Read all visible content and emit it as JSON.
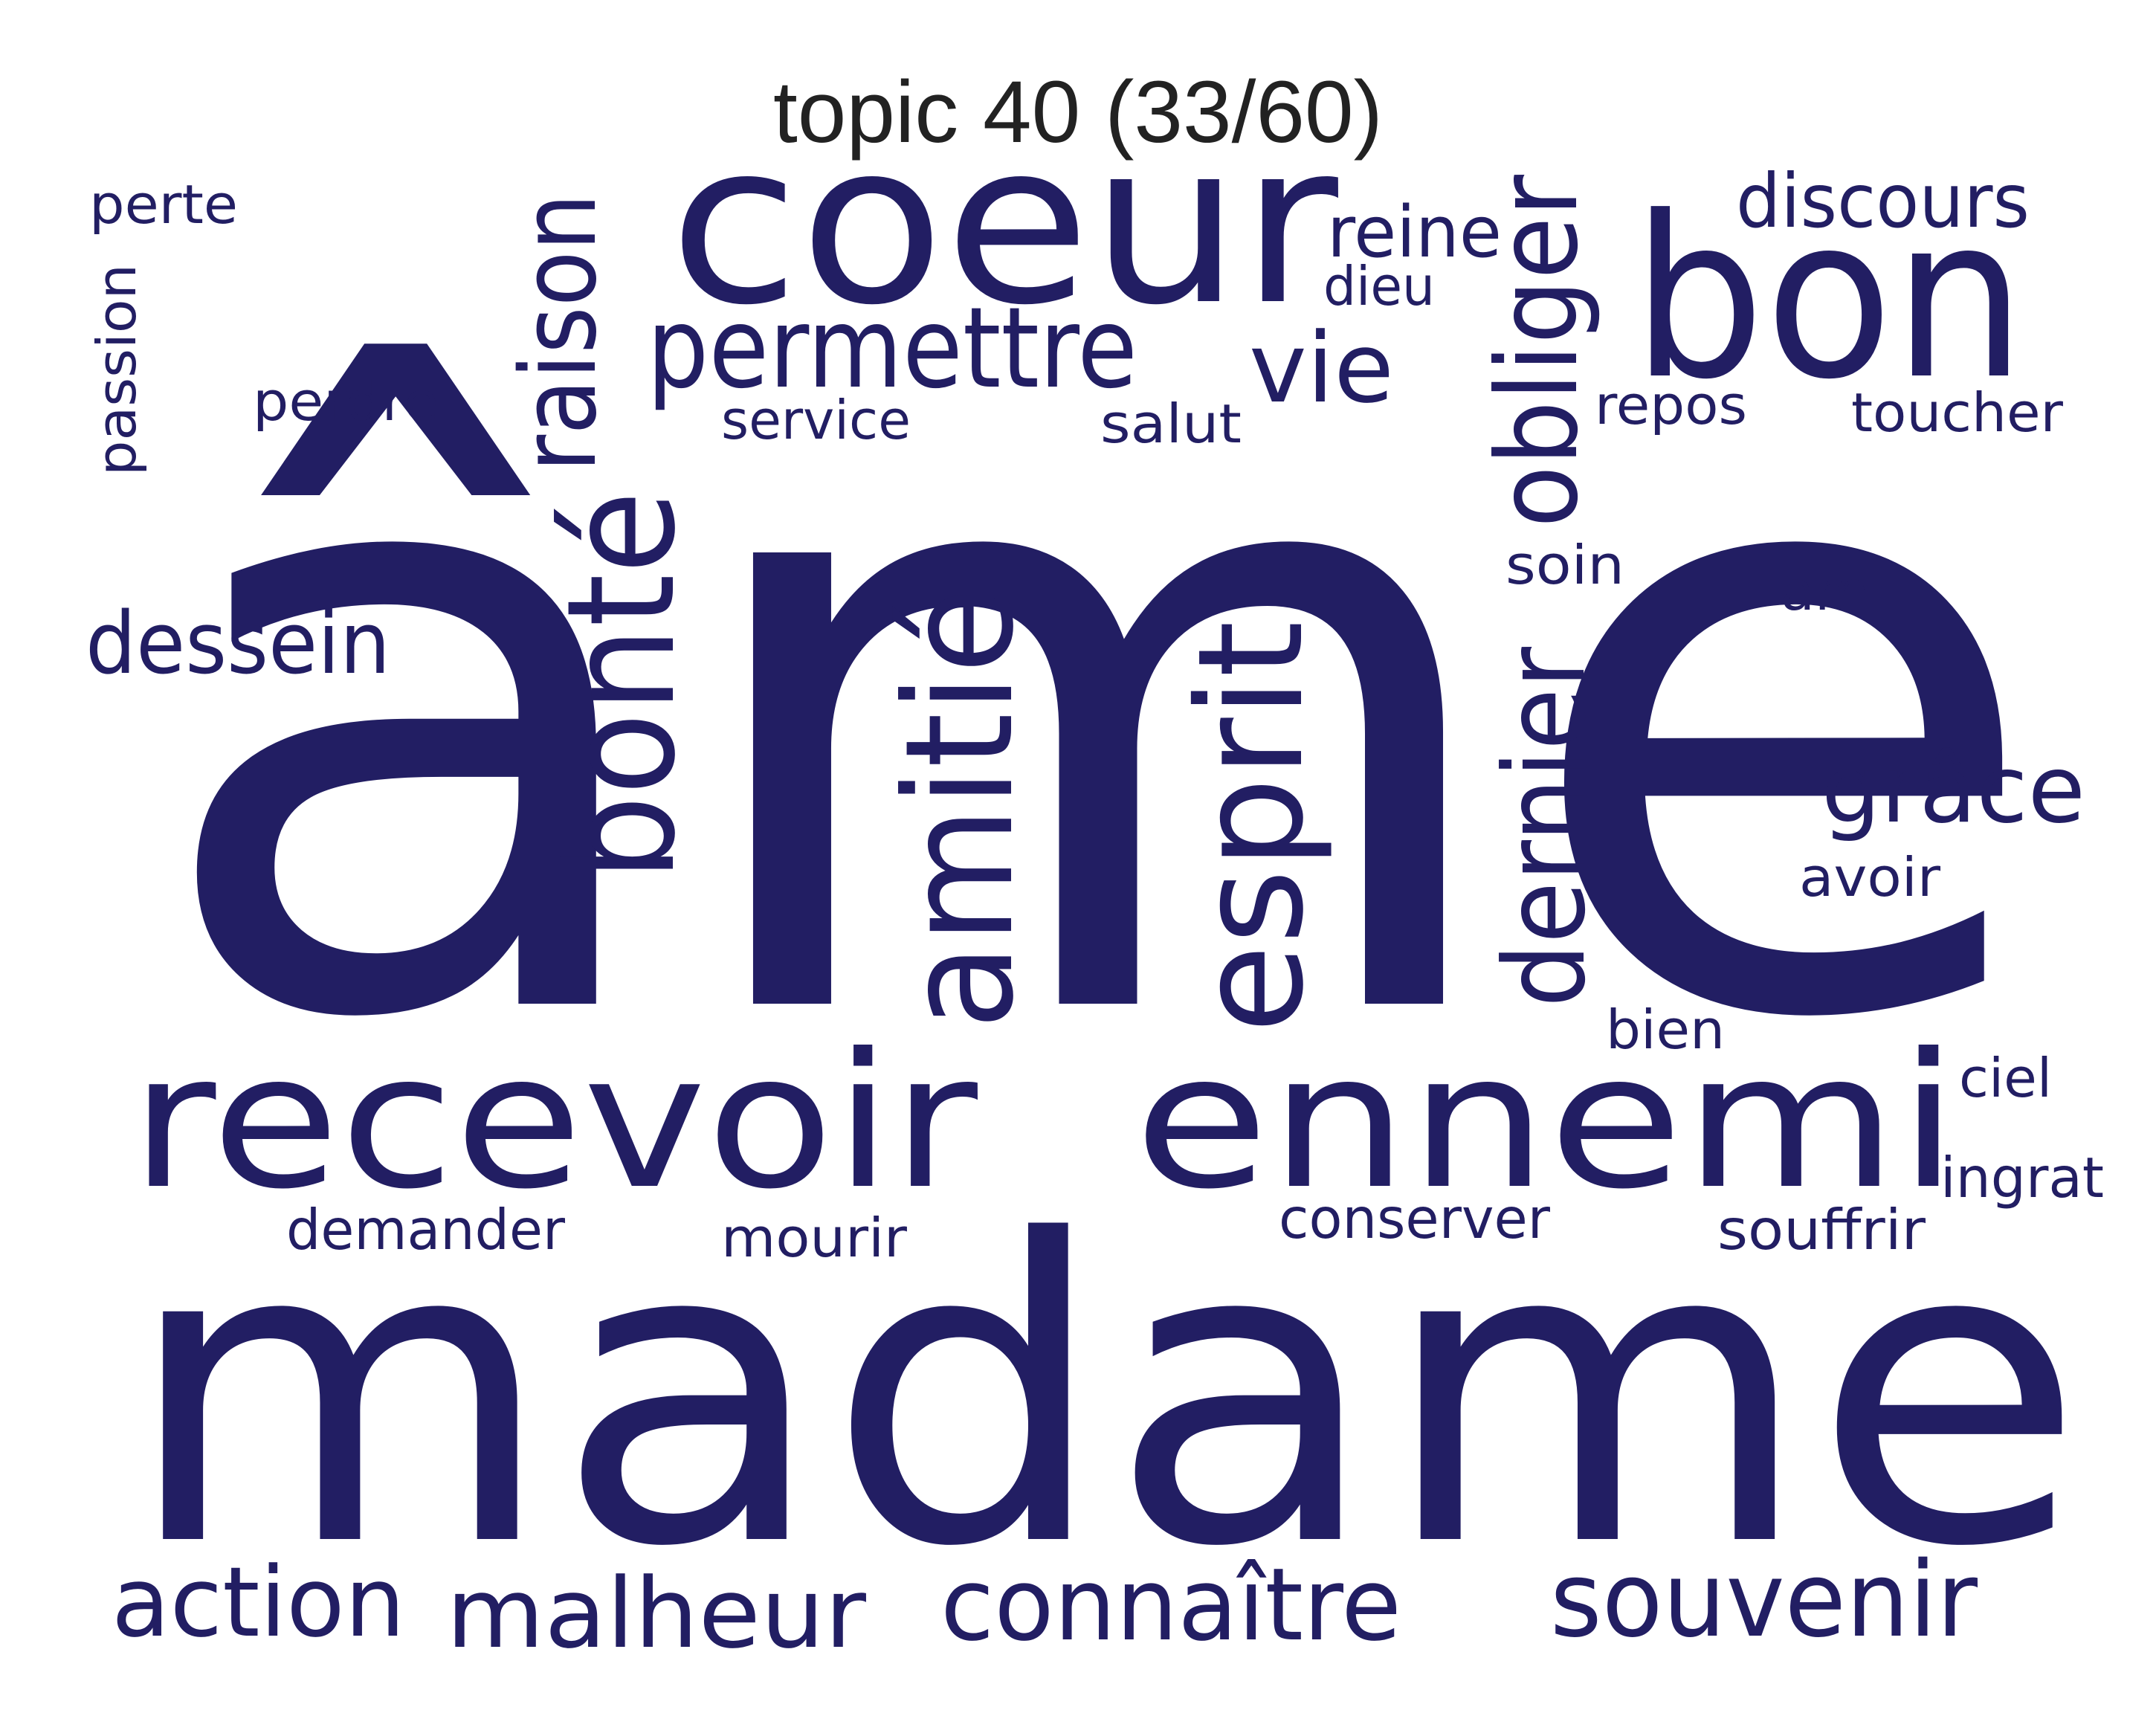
{
  "title": "topic 40 (33/60)",
  "color": "#221e63",
  "words": [
    {
      "id": "ame",
      "text": "âme",
      "weight": 1.0,
      "vertical": false
    },
    {
      "id": "madame",
      "text": "madame",
      "weight": 0.78,
      "vertical": false
    },
    {
      "id": "coeur",
      "text": "coeur",
      "weight": 0.42,
      "vertical": false
    },
    {
      "id": "bon",
      "text": "bon",
      "weight": 0.42,
      "vertical": false
    },
    {
      "id": "recevoir",
      "text": "recevoir",
      "weight": 0.36,
      "vertical": false
    },
    {
      "id": "ennemi",
      "text": "ennemi",
      "weight": 0.34,
      "vertical": false
    },
    {
      "id": "amitie",
      "text": "amitié",
      "weight": 0.3,
      "vertical": true
    },
    {
      "id": "bonte",
      "text": "bonté",
      "weight": 0.28,
      "vertical": true
    },
    {
      "id": "esprit",
      "text": "esprit",
      "weight": 0.28,
      "vertical": true
    },
    {
      "id": "dernier",
      "text": "dernier",
      "weight": 0.22,
      "vertical": true
    },
    {
      "id": "permettre",
      "text": "permettre",
      "weight": 0.22,
      "vertical": false
    },
    {
      "id": "obliger",
      "text": "obliger",
      "weight": 0.21,
      "vertical": true
    },
    {
      "id": "raison",
      "text": "raison",
      "weight": 0.2,
      "vertical": true
    },
    {
      "id": "souvenir",
      "text": "souvenir",
      "weight": 0.19,
      "vertical": false
    },
    {
      "id": "connaitre",
      "text": "connaître",
      "weight": 0.18,
      "vertical": false
    },
    {
      "id": "malheur",
      "text": "malheur",
      "weight": 0.18,
      "vertical": false
    },
    {
      "id": "action",
      "text": "action",
      "weight": 0.18,
      "vertical": false
    },
    {
      "id": "grace",
      "text": "grâce",
      "weight": 0.18,
      "vertical": false
    },
    {
      "id": "vie",
      "text": "vie",
      "weight": 0.17,
      "vertical": false
    },
    {
      "id": "dessein",
      "text": "dessein",
      "weight": 0.15,
      "vertical": false
    },
    {
      "id": "discours",
      "text": "discours",
      "weight": 0.14,
      "vertical": false
    },
    {
      "id": "reine",
      "text": "reine",
      "weight": 0.13,
      "vertical": false
    },
    {
      "id": "ingrat",
      "text": "ingrat",
      "weight": 0.1,
      "vertical": false
    },
    {
      "id": "demander",
      "text": "demander",
      "weight": 0.1,
      "vertical": false
    },
    {
      "id": "souffrir",
      "text": "souffrir",
      "weight": 0.1,
      "vertical": false
    },
    {
      "id": "conserver",
      "text": "conserver",
      "weight": 0.1,
      "vertical": false
    },
    {
      "id": "bien",
      "text": "bien",
      "weight": 0.1,
      "vertical": false
    },
    {
      "id": "ciel",
      "text": "ciel",
      "weight": 0.1,
      "vertical": false
    },
    {
      "id": "mourir",
      "text": "mourir",
      "weight": 0.1,
      "vertical": false
    },
    {
      "id": "perte",
      "text": "perte",
      "weight": 0.09,
      "vertical": false
    },
    {
      "id": "passion",
      "text": "passion",
      "weight": 0.09,
      "vertical": true
    },
    {
      "id": "perdre",
      "text": "perdre",
      "weight": 0.09,
      "vertical": false
    },
    {
      "id": "service",
      "text": "service",
      "weight": 0.09,
      "vertical": false
    },
    {
      "id": "salut",
      "text": "salut",
      "weight": 0.09,
      "vertical": false
    },
    {
      "id": "repos",
      "text": "repos",
      "weight": 0.09,
      "vertical": false
    },
    {
      "id": "toucher",
      "text": "toucher",
      "weight": 0.09,
      "vertical": false
    },
    {
      "id": "soin",
      "text": "soin",
      "weight": 0.09,
      "vertical": false
    },
    {
      "id": "ami",
      "text": "ami",
      "weight": 0.09,
      "vertical": false
    },
    {
      "id": "avoir",
      "text": "avoir",
      "weight": 0.09,
      "vertical": false
    },
    {
      "id": "dieu",
      "text": "dieu",
      "weight": 0.09,
      "vertical": false
    }
  ]
}
